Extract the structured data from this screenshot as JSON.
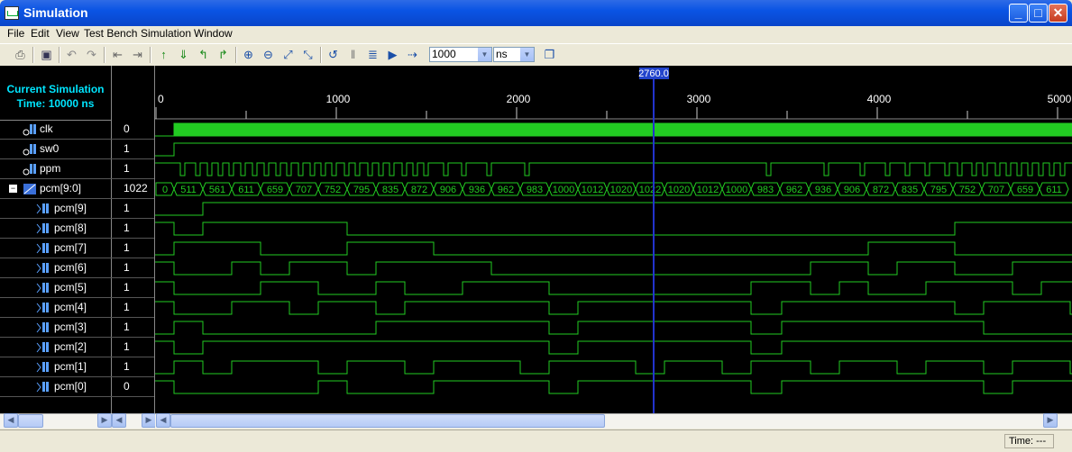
{
  "window": {
    "title": "Simulation"
  },
  "menu": [
    "File",
    "Edit",
    "View",
    "Test Bench",
    "Simulation",
    "Window"
  ],
  "toolbar": {
    "sim_time_value": "1000",
    "time_unit": "ns"
  },
  "header": {
    "line1": "Current Simulation",
    "line2": "Time: 10000 ns"
  },
  "cursor": {
    "time": 2760,
    "label": "2760.0"
  },
  "timescale": {
    "ticks": [
      "0",
      "1000",
      "2000",
      "3000",
      "4000",
      "5000"
    ]
  },
  "signals": [
    {
      "name": "clk",
      "value": "0",
      "kind": "input"
    },
    {
      "name": "sw0",
      "value": "1",
      "kind": "input"
    },
    {
      "name": "ppm",
      "value": "1",
      "kind": "input"
    },
    {
      "name": "pcm[9:0]",
      "value": "1022",
      "kind": "bus"
    },
    {
      "name": "pcm[9]",
      "value": "1",
      "kind": "bit"
    },
    {
      "name": "pcm[8]",
      "value": "1",
      "kind": "bit"
    },
    {
      "name": "pcm[7]",
      "value": "1",
      "kind": "bit"
    },
    {
      "name": "pcm[6]",
      "value": "1",
      "kind": "bit"
    },
    {
      "name": "pcm[5]",
      "value": "1",
      "kind": "bit"
    },
    {
      "name": "pcm[4]",
      "value": "1",
      "kind": "bit"
    },
    {
      "name": "pcm[3]",
      "value": "1",
      "kind": "bit"
    },
    {
      "name": "pcm[2]",
      "value": "1",
      "kind": "bit"
    },
    {
      "name": "pcm[1]",
      "value": "1",
      "kind": "bit"
    },
    {
      "name": "pcm[0]",
      "value": "0",
      "kind": "bit"
    }
  ],
  "bus_values": [
    "0",
    "511",
    "561",
    "611",
    "659",
    "707",
    "752",
    "795",
    "835",
    "872",
    "906",
    "936",
    "962",
    "983",
    "1000",
    "1012",
    "1020",
    "1022",
    "1020",
    "1012",
    "1000",
    "983",
    "962",
    "936",
    "906",
    "872",
    "835",
    "795",
    "752",
    "707",
    "659",
    "611"
  ],
  "status": {
    "time_label": "Time: ---"
  },
  "colors": {
    "wave": "#22cc22",
    "cursor": "#2233cc",
    "header_text": "#00e5ff"
  }
}
